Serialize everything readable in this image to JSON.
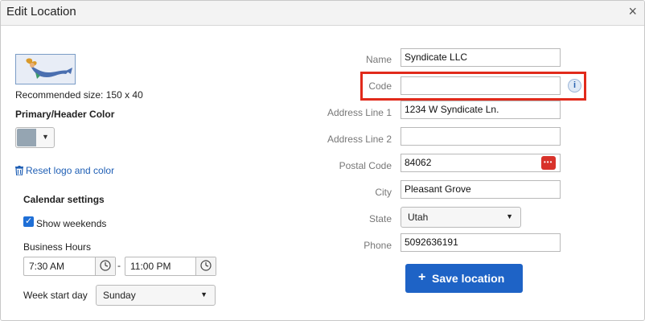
{
  "dialog": {
    "title": "Edit Location",
    "close_glyph": "×"
  },
  "branding": {
    "recommended_size": "Recommended size: 150 x 40",
    "primary_color_label": "Primary/Header Color",
    "primary_color": "#95a5b2",
    "reset_label": "Reset logo and color",
    "reset_icon": "trash-icon"
  },
  "calendar": {
    "title": "Calendar settings",
    "show_weekends_label": "Show weekends",
    "show_weekends_checked": true,
    "business_hours_label": "Business Hours",
    "start_time": "7:30 AM",
    "end_time": "11:00 PM",
    "range_separator": "-",
    "week_start_label": "Week start day",
    "week_start_value": "Sunday"
  },
  "location": {
    "name_label": "Name",
    "name_value": "Syndicate LLC",
    "code_label": "Code",
    "code_value": "",
    "address1_label": "Address Line 1",
    "address1_value": "1234 W Syndicate Ln.",
    "address2_label": "Address Line 2",
    "address2_value": "",
    "postal_label": "Postal Code",
    "postal_value": "84062",
    "city_label": "City",
    "city_value": "Pleasant Grove",
    "state_label": "State",
    "state_value": "Utah",
    "phone_label": "Phone",
    "phone_value": "5092636191",
    "info_glyph": "i"
  },
  "actions": {
    "save_label": "Save location",
    "save_plus": "+"
  },
  "colors": {
    "accent": "#1e63c6",
    "highlight": "#e12a1b",
    "postal_button": "#d8322a"
  }
}
